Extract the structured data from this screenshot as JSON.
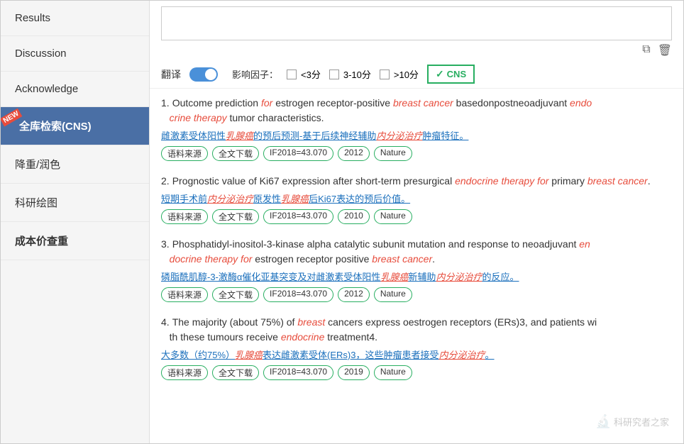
{
  "sidebar": {
    "items": [
      {
        "id": "results",
        "label": "Results",
        "active": false
      },
      {
        "id": "discussion",
        "label": "Discussion",
        "active": false
      },
      {
        "id": "acknowledge",
        "label": "Acknowledge",
        "active": false
      },
      {
        "id": "full-search",
        "label": "全库检索(CNS)",
        "active": true,
        "badge": "NEW"
      },
      {
        "id": "highlight",
        "label": "降重/润色",
        "active": false
      },
      {
        "id": "chart",
        "label": "科研绘图",
        "active": false
      },
      {
        "id": "cost",
        "label": "成本价查重",
        "active": false,
        "bold": true
      }
    ]
  },
  "toolbar": {
    "translate_label": "翻译",
    "filter_label": "影响因子：",
    "option1": "<3分",
    "option2": "3-10分",
    "option3": ">10分",
    "cns_label": "CNS",
    "copy_icon": "⧉",
    "trash_icon": "🗑"
  },
  "results": [
    {
      "num": "1.",
      "title_plain": "Outcome prediction ",
      "title_italic1": "for",
      "title_mid": " estrogen receptor-positive ",
      "title_italic2": "breast cancer",
      "title_end": " basedonpostneoadjuvant ",
      "title_red1": "endo",
      "title_red2": "crine therapy",
      "title_last": " tumor characteristics.",
      "subtitle": "雌激素受体阳性乳腺癌的预后预测-基于后续神经辅助内分泌治疗肿瘤特征。",
      "tags": [
        "语料来源",
        "全文下载",
        "IF2018=43.070",
        "2012",
        "Nature"
      ]
    },
    {
      "num": "2.",
      "title_plain": "Prognostic value of Ki67 expression after short-term presurgical ",
      "title_italic1": "endocrine therapy for",
      "title_mid": " primary ",
      "title_red": "breast cancer",
      "title_end": ".",
      "subtitle": "短期手术前内分泌治疗原发性乳腺癌后Ki67表达的预后价值。",
      "tags": [
        "语料来源",
        "全文下载",
        "IF2018=43.070",
        "2010",
        "Nature"
      ]
    },
    {
      "num": "3.",
      "title_plain": "Phosphatidyl-inositol-3-kinase alpha catalytic subunit mutation and response to neoadjuvant ",
      "title_italic1": "en",
      "title_red1": "docrine therapy for",
      "title_mid": " estrogen receptor positive ",
      "title_red2": "breast cancer",
      "title_end": ".",
      "subtitle": "磷脂酰肌醇-3-激酶α催化亚基突变及对雌激素受体阳性乳腺癌新辅助内分泌治疗的反应。",
      "tags": [
        "语料来源",
        "全文下载",
        "IF2018=43.070",
        "2012",
        "Nature"
      ]
    },
    {
      "num": "4.",
      "title_plain": "The majority (about 75%) of ",
      "title_italic1": "breast",
      "title_mid": " cancers express oestrogen receptors (ERs)3, and patients with these tumours receive ",
      "title_red": "endocrine",
      "title_end": " treatment4.",
      "subtitle": "大多数（约75%）乳腺癌表达雌激素受体(ERs)3，这些肿瘤患者接受内分泌治疗。",
      "tags": [
        "语料来源",
        "全文下载",
        "IF2018=43.070",
        "2019",
        "Nature"
      ]
    }
  ],
  "watermark": "科研究者之家"
}
